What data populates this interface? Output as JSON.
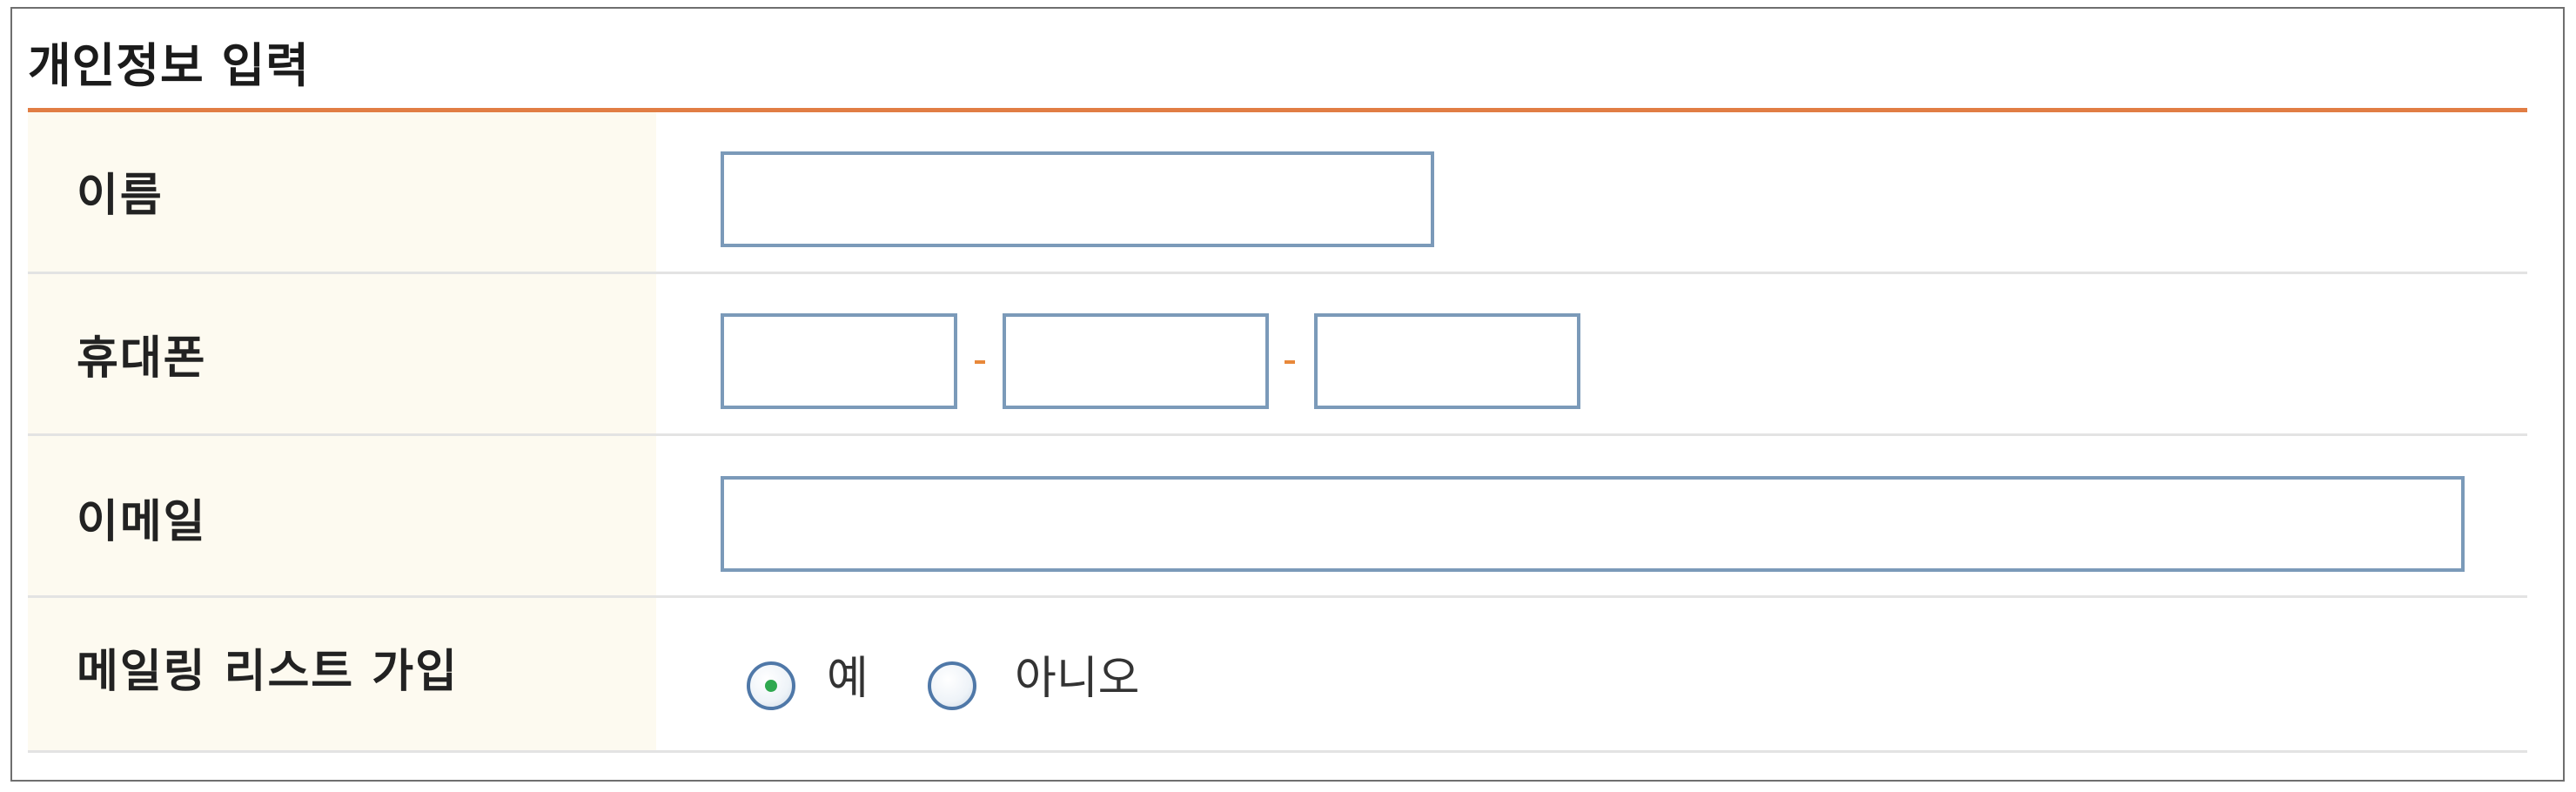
{
  "section": {
    "title": "개인정보 입력"
  },
  "rows": {
    "name": {
      "label": "이름",
      "value": ""
    },
    "phone": {
      "label": "휴대폰",
      "part1": "",
      "part2": "",
      "part3": "",
      "separator": "-"
    },
    "email": {
      "label": "이메일",
      "value": ""
    },
    "mailing": {
      "label": "메일링 리스트 가입",
      "options": [
        {
          "label": "예",
          "selected": true
        },
        {
          "label": "아니오",
          "selected": false
        }
      ]
    }
  },
  "colors": {
    "accent_line": "#e17d44",
    "field_border": "#7b9ab9",
    "label_background": "#fdfaf0",
    "radio_selected_dot": "#2fa84f"
  }
}
